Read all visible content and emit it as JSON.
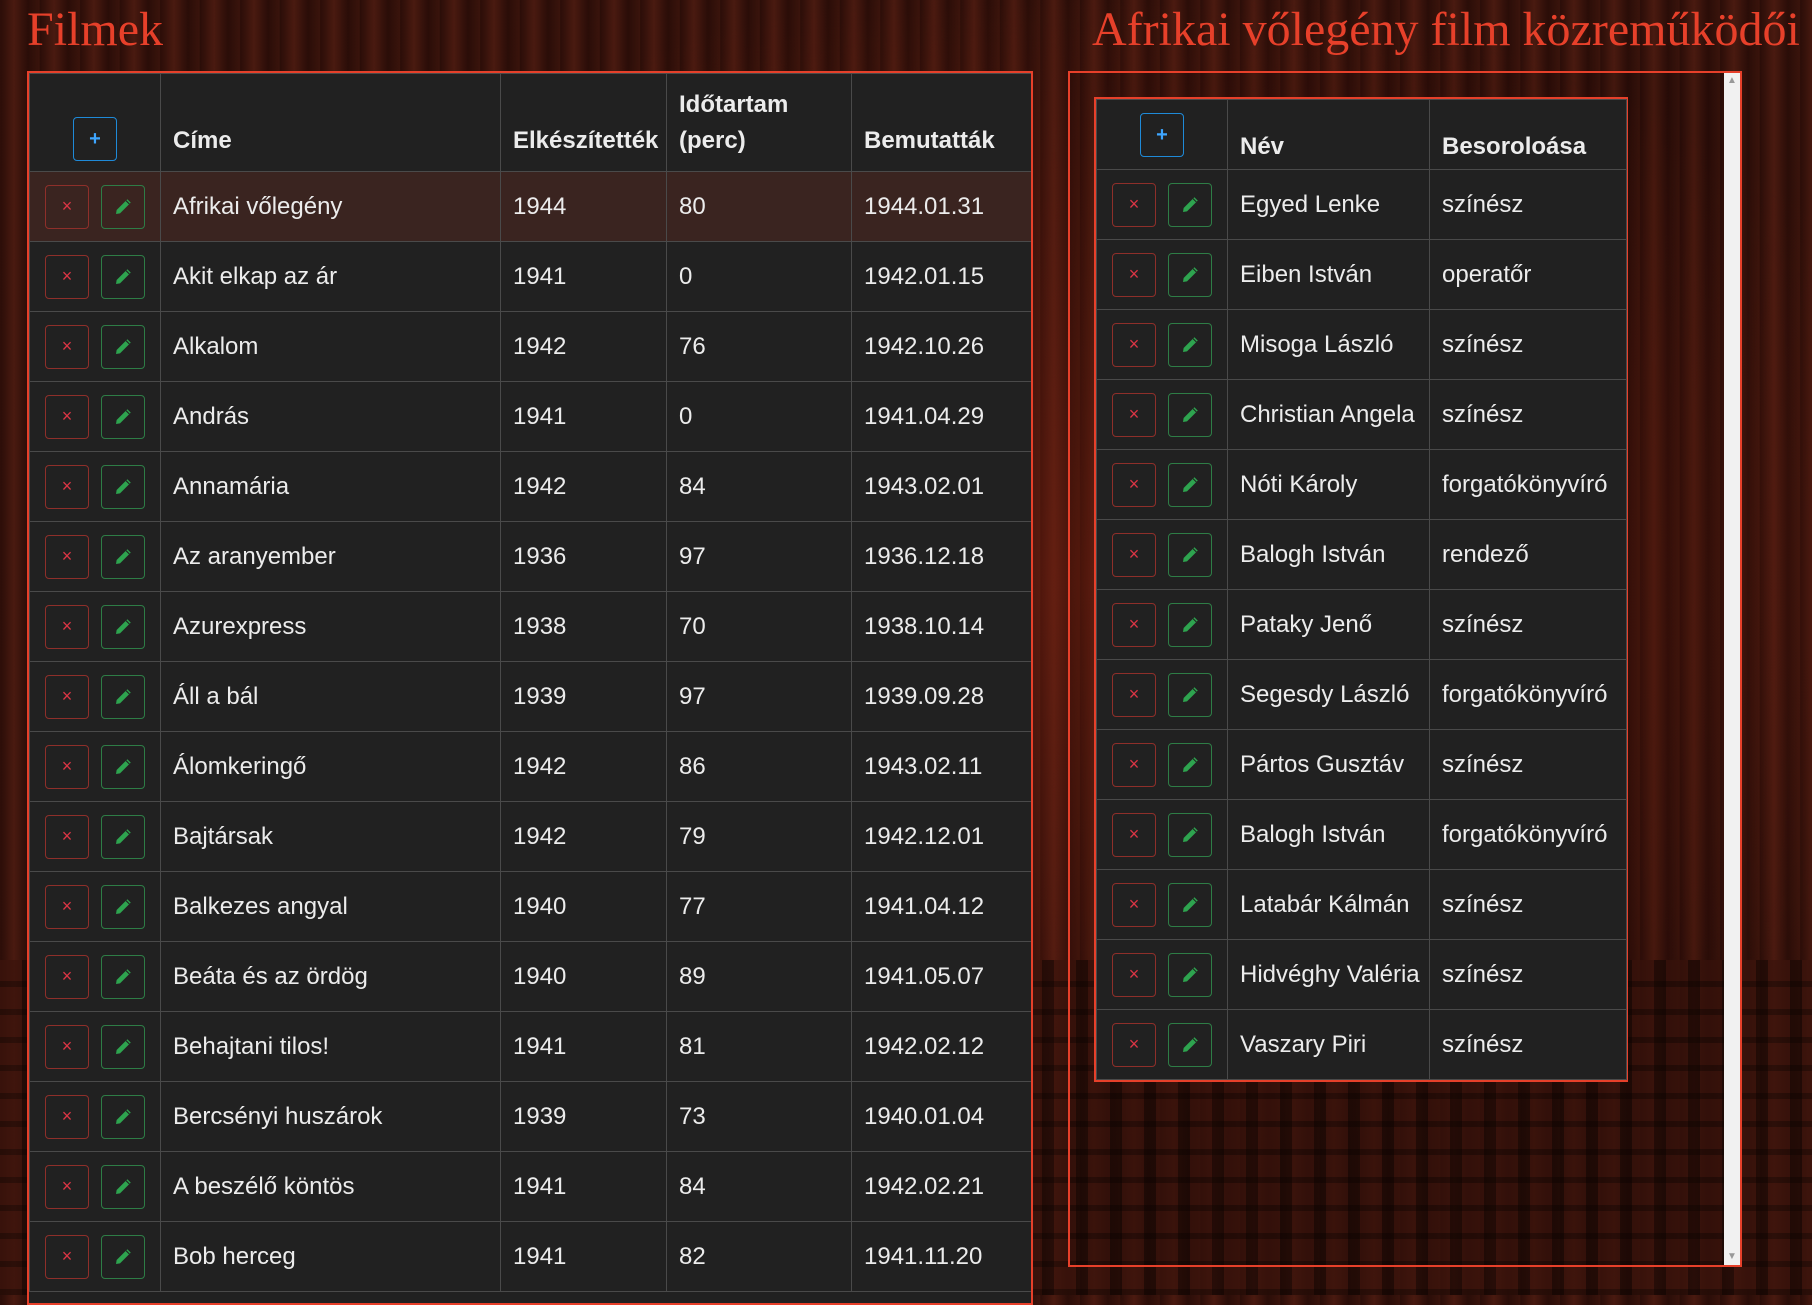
{
  "films_title": "Filmek",
  "contributors_title": "Afrikai vőlegény film közreműködői",
  "icons": {
    "add": "+",
    "delete": "×"
  },
  "films": {
    "headers": {
      "title": "Címe",
      "made": "Elkészítették",
      "duration_l1": "Időtartam",
      "duration_l2": "(perc)",
      "premiere": "Bemutatták"
    },
    "rows": [
      {
        "title": "Afrikai vőlegény",
        "made": "1944",
        "duration": "80",
        "premiere": "1944.01.31"
      },
      {
        "title": "Akit elkap az ár",
        "made": "1941",
        "duration": "0",
        "premiere": "1942.01.15"
      },
      {
        "title": "Alkalom",
        "made": "1942",
        "duration": "76",
        "premiere": "1942.10.26"
      },
      {
        "title": "András",
        "made": "1941",
        "duration": "0",
        "premiere": "1941.04.29"
      },
      {
        "title": "Annamária",
        "made": "1942",
        "duration": "84",
        "premiere": "1943.02.01"
      },
      {
        "title": "Az aranyember",
        "made": "1936",
        "duration": "97",
        "premiere": "1936.12.18"
      },
      {
        "title": "Azurexpress",
        "made": "1938",
        "duration": "70",
        "premiere": "1938.10.14"
      },
      {
        "title": "Áll a bál",
        "made": "1939",
        "duration": "97",
        "premiere": "1939.09.28"
      },
      {
        "title": "Álomkeringő",
        "made": "1942",
        "duration": "86",
        "premiere": "1943.02.11"
      },
      {
        "title": "Bajtársak",
        "made": "1942",
        "duration": "79",
        "premiere": "1942.12.01"
      },
      {
        "title": "Balkezes angyal",
        "made": "1940",
        "duration": "77",
        "premiere": "1941.04.12"
      },
      {
        "title": "Beáta és az ördög",
        "made": "1940",
        "duration": "89",
        "premiere": "1941.05.07"
      },
      {
        "title": "Behajtani tilos!",
        "made": "1941",
        "duration": "81",
        "premiere": "1942.02.12"
      },
      {
        "title": "Bercsényi huszárok",
        "made": "1939",
        "duration": "73",
        "premiere": "1940.01.04"
      },
      {
        "title": "A beszélő köntös",
        "made": "1941",
        "duration": "84",
        "premiere": "1942.02.21"
      },
      {
        "title": "Bob herceg",
        "made": "1941",
        "duration": "82",
        "premiere": "1941.11.20"
      }
    ]
  },
  "contributors": {
    "headers": {
      "name": "Név",
      "role": "Besoroloása"
    },
    "rows": [
      {
        "name": "Egyed Lenke",
        "role": "színész"
      },
      {
        "name": "Eiben István",
        "role": "operatőr"
      },
      {
        "name": "Misoga László",
        "role": "színész"
      },
      {
        "name": "Christian Angela",
        "role": "színész"
      },
      {
        "name": "Nóti Károly",
        "role": "forgatókönyvíró"
      },
      {
        "name": "Balogh István",
        "role": "rendező"
      },
      {
        "name": "Pataky Jenő",
        "role": "színész"
      },
      {
        "name": "Segesdy László",
        "role": "forgatókönyvíró"
      },
      {
        "name": "Pártos Gusztáv",
        "role": "színész"
      },
      {
        "name": "Balogh István",
        "role": "forgatókönyvíró"
      },
      {
        "name": "Latabár Kálmán",
        "role": "színész"
      },
      {
        "name": "Hidvéghy Valéria",
        "role": "színész"
      },
      {
        "name": "Vaszary Piri",
        "role": "színész"
      }
    ]
  }
}
